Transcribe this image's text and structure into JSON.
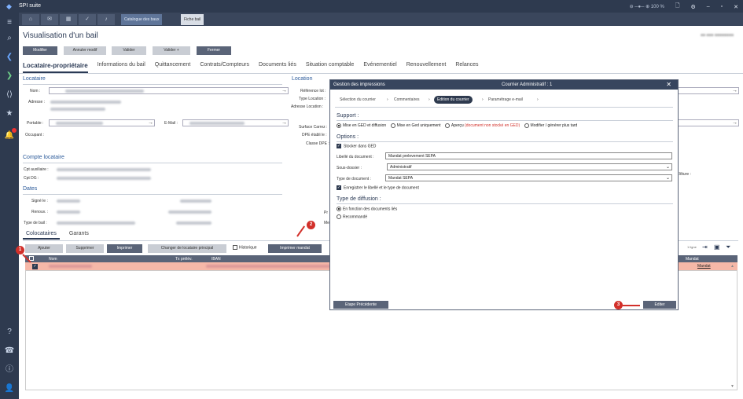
{
  "app": {
    "name": "SPI suite",
    "zoom": "100 %"
  },
  "tabs": {
    "catalogue": "Catalogue des baux",
    "fiche": "Fiche bail"
  },
  "page": {
    "title": "Visualisation d'un bail"
  },
  "toolbar": {
    "modifier": "Modifier",
    "annuler": "Annuler modif",
    "valider": "Valider",
    "valider_plus": "Valider +",
    "fermer": "Fermer"
  },
  "section_tabs": [
    "Locataire-propriétaire",
    "Informations du bail",
    "Quittancement",
    "Contrats/Compteurs",
    "Documents liés",
    "Situation comptable",
    "Evénementiel",
    "Renouvellement",
    "Relances"
  ],
  "locataire": {
    "title": "Locataire",
    "nom": "Nom :",
    "adresse": "Adresse :",
    "portable": "Portable :",
    "email": "E-Mail :",
    "occupant": "Occupant :"
  },
  "location": {
    "title": "Location",
    "ref_lot": "Référence lot :",
    "type_location": "Type Location :",
    "adresse_location": "Adresse Location :",
    "surface": "Surface Carrez :",
    "dpe": "DPE établi le :",
    "classe_dpe": "Classe DPE :",
    "cloture": "Clôture :",
    "pr": "Pr",
    "me": "Me"
  },
  "compte": {
    "title": "Compte locataire",
    "cpt_aux": "Cpt auxiliaire :",
    "cpt_dg": "Cpt DG :"
  },
  "dates": {
    "title": "Dates",
    "signe": "Signé le :",
    "renouv": "Renouv. :",
    "type_bail": "Type de bail :"
  },
  "bottom_tabs": {
    "colocataires": "Colocataires",
    "garants": "Garants"
  },
  "bottom_toolbar": {
    "ajouter": "Ajouter",
    "supprimer": "Supprimer",
    "imprimer": "Imprimer",
    "changer": "Changer de locataire principal",
    "historique": "Historique",
    "imprimer_mandat": "Imprimer mandat",
    "count": "1 ligne"
  },
  "grid": {
    "headers": [
      "Nom",
      "Tx prélèv.",
      "IBAN",
      "Mandat"
    ],
    "row_mandat": "Mandat"
  },
  "dialog": {
    "title": "Gestion des impressions",
    "subtitle": "Courrier Administratif : 1",
    "steps": [
      "Sélection du courrier",
      "Commentaires",
      "Edition du courrier",
      "Paramétrage e-mail"
    ],
    "support_title": "Support :",
    "support_options": [
      "Mise en GED et diffusion",
      "Mise en Ged uniquement",
      "Aperçu",
      "(document non stocké en GED)",
      "Modifier / générer plus tard"
    ],
    "options_title": "Options :",
    "stocker": "Stocker dans GED",
    "libelle_label": "Libellé du document :",
    "libelle_value": "Mandat prelevement SEPA",
    "sousdossier_label": "Sous-dossier :",
    "sousdossier_value": "Administratif",
    "typedoc_label": "Type de document :",
    "typedoc_value": "Mandat SEPA",
    "enregistrer": "Enregistrer le libellé et le type de document",
    "diffusion_title": "Type de diffusion :",
    "diffusion_options": [
      "En fonction des documents liés",
      "Recommandé"
    ],
    "prev_button": "Etape Précédente",
    "edit_button": "Editer"
  },
  "callouts": [
    "1",
    "2",
    "3"
  ]
}
